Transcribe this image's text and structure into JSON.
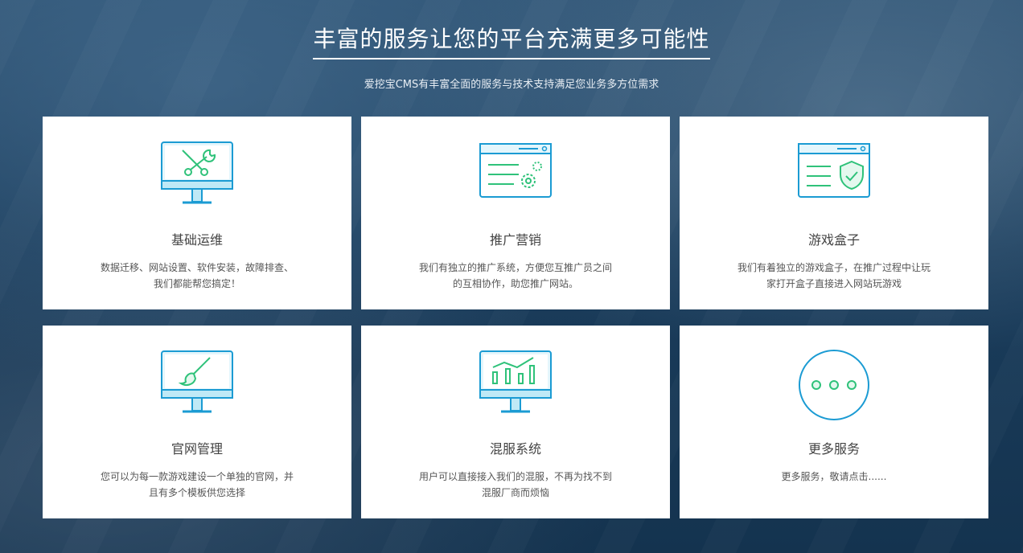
{
  "header": {
    "title": "丰富的服务让您的平台充满更多可能性",
    "subtitle": "爱挖宝CMS有丰富全面的服务与技术支持满足您业务多方位需求"
  },
  "colors": {
    "icon_blue": "#1b9bd3",
    "icon_green": "#2fc27a",
    "card_bg": "#ffffff"
  },
  "cards": [
    {
      "icon": "monitor-tools-icon",
      "title": "基础运维",
      "desc": "数据迁移、网站设置、软件安装，故障排查、我们都能帮您搞定！"
    },
    {
      "icon": "browser-gears-icon",
      "title": "推广营销",
      "desc": "我们有独立的推广系统，方便您互推广员之间的互相协作，助您推广网站。"
    },
    {
      "icon": "browser-shield-icon",
      "title": "游戏盒子",
      "desc": "我们有着独立的游戏盒子，在推广过程中让玩家打开盒子直接进入网站玩游戏"
    },
    {
      "icon": "monitor-brush-icon",
      "title": "官网管理",
      "desc": "您可以为每一款游戏建设一个单独的官网，并且有多个模板供您选择"
    },
    {
      "icon": "monitor-chart-icon",
      "title": "混服系统",
      "desc": "用户可以直接接入我们的混服，不再为找不到混服厂商而烦恼"
    },
    {
      "icon": "more-dots-icon",
      "title": "更多服务",
      "desc": "更多服务，敬请点击......"
    }
  ]
}
